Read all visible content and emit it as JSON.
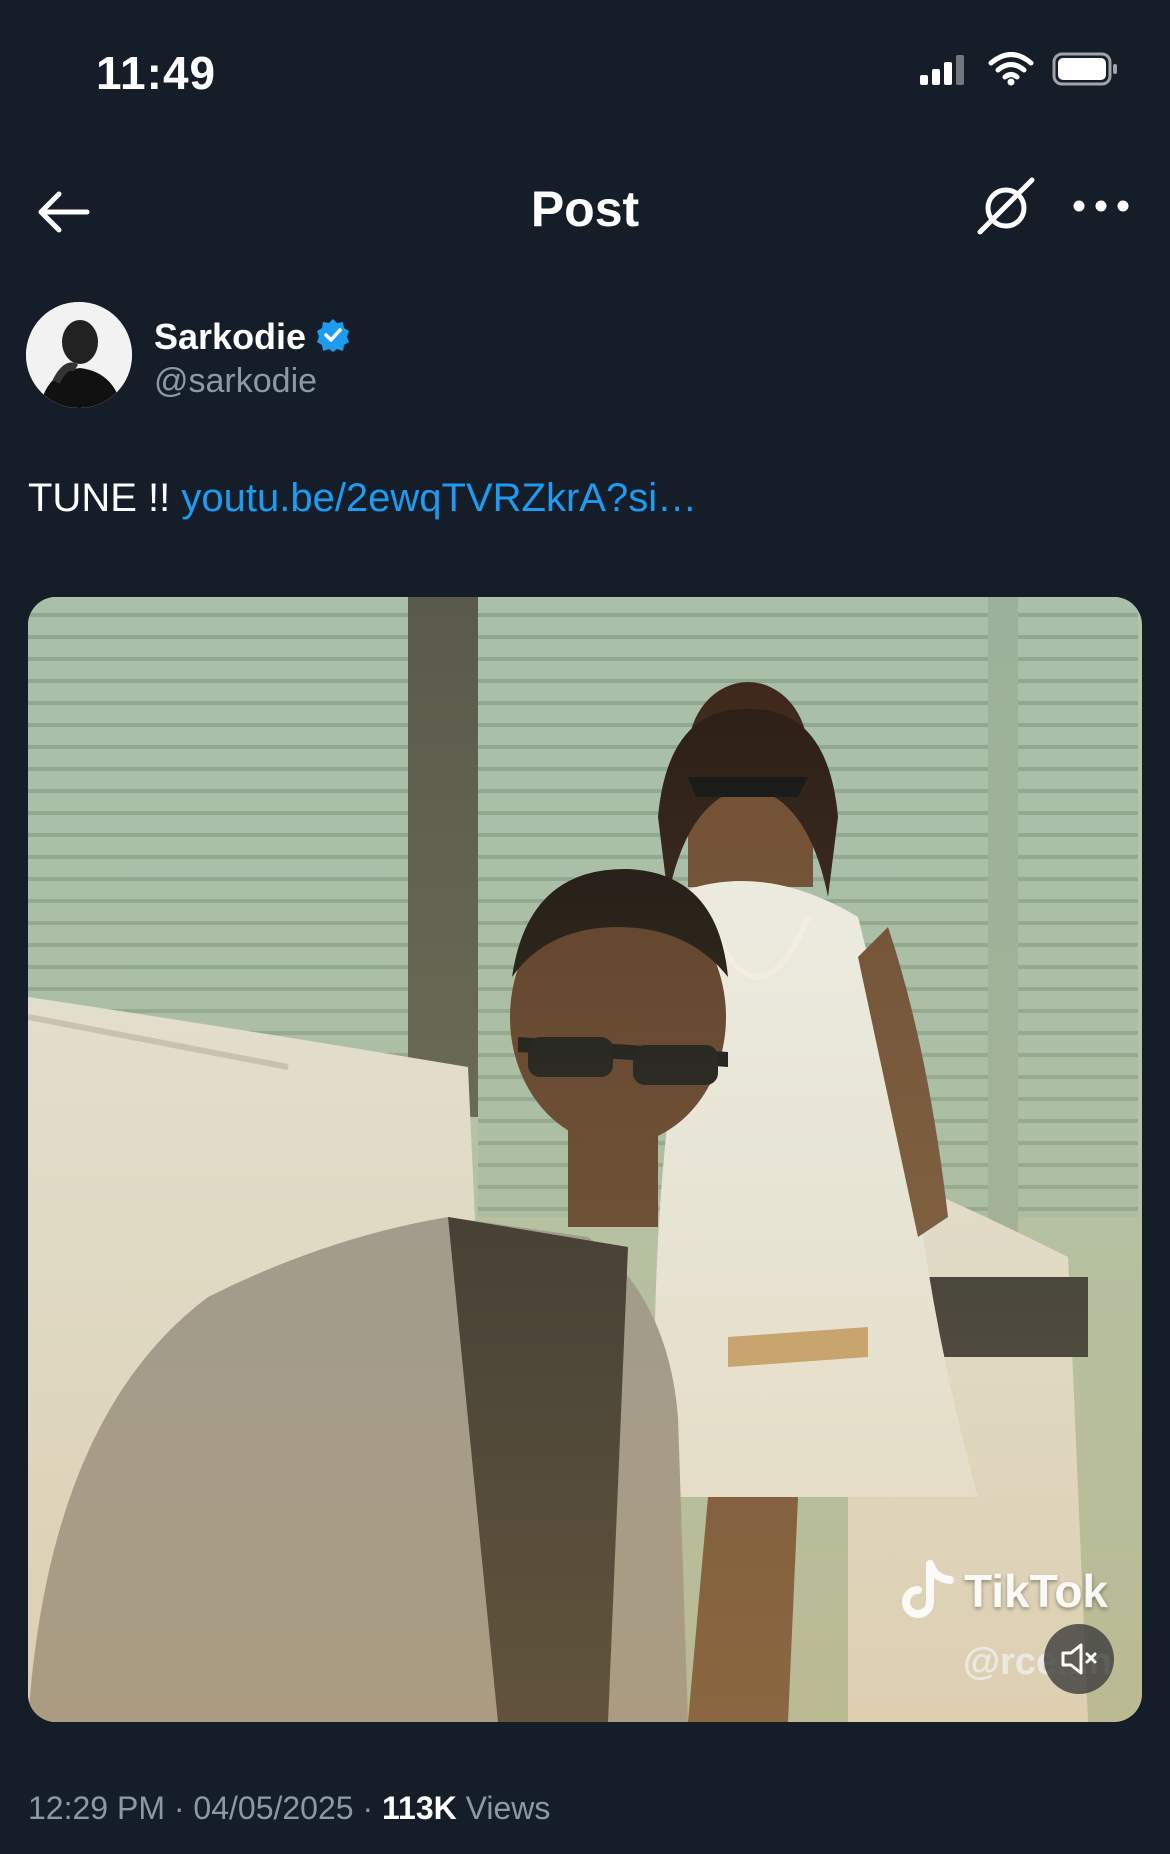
{
  "status_bar": {
    "time": "11:49"
  },
  "nav": {
    "title": "Post"
  },
  "author": {
    "name": "Sarkodie",
    "handle": "@sarkodie",
    "verified": true
  },
  "post": {
    "text_prefix": "TUNE !!",
    "link_text": "youtu.be/2ewqTVRZkrA?si…"
  },
  "media": {
    "watermark_brand": "TikTok",
    "watermark_handle": "@rce...n"
  },
  "meta": {
    "time": "12:29 PM",
    "separator": "·",
    "date": "04/05/2025",
    "views_count": "113K",
    "views_label": "Views"
  },
  "colors": {
    "background": "#151d29",
    "link": "#1d9bf0",
    "verified": "#1d9bf0",
    "muted": "#8b98a5"
  }
}
